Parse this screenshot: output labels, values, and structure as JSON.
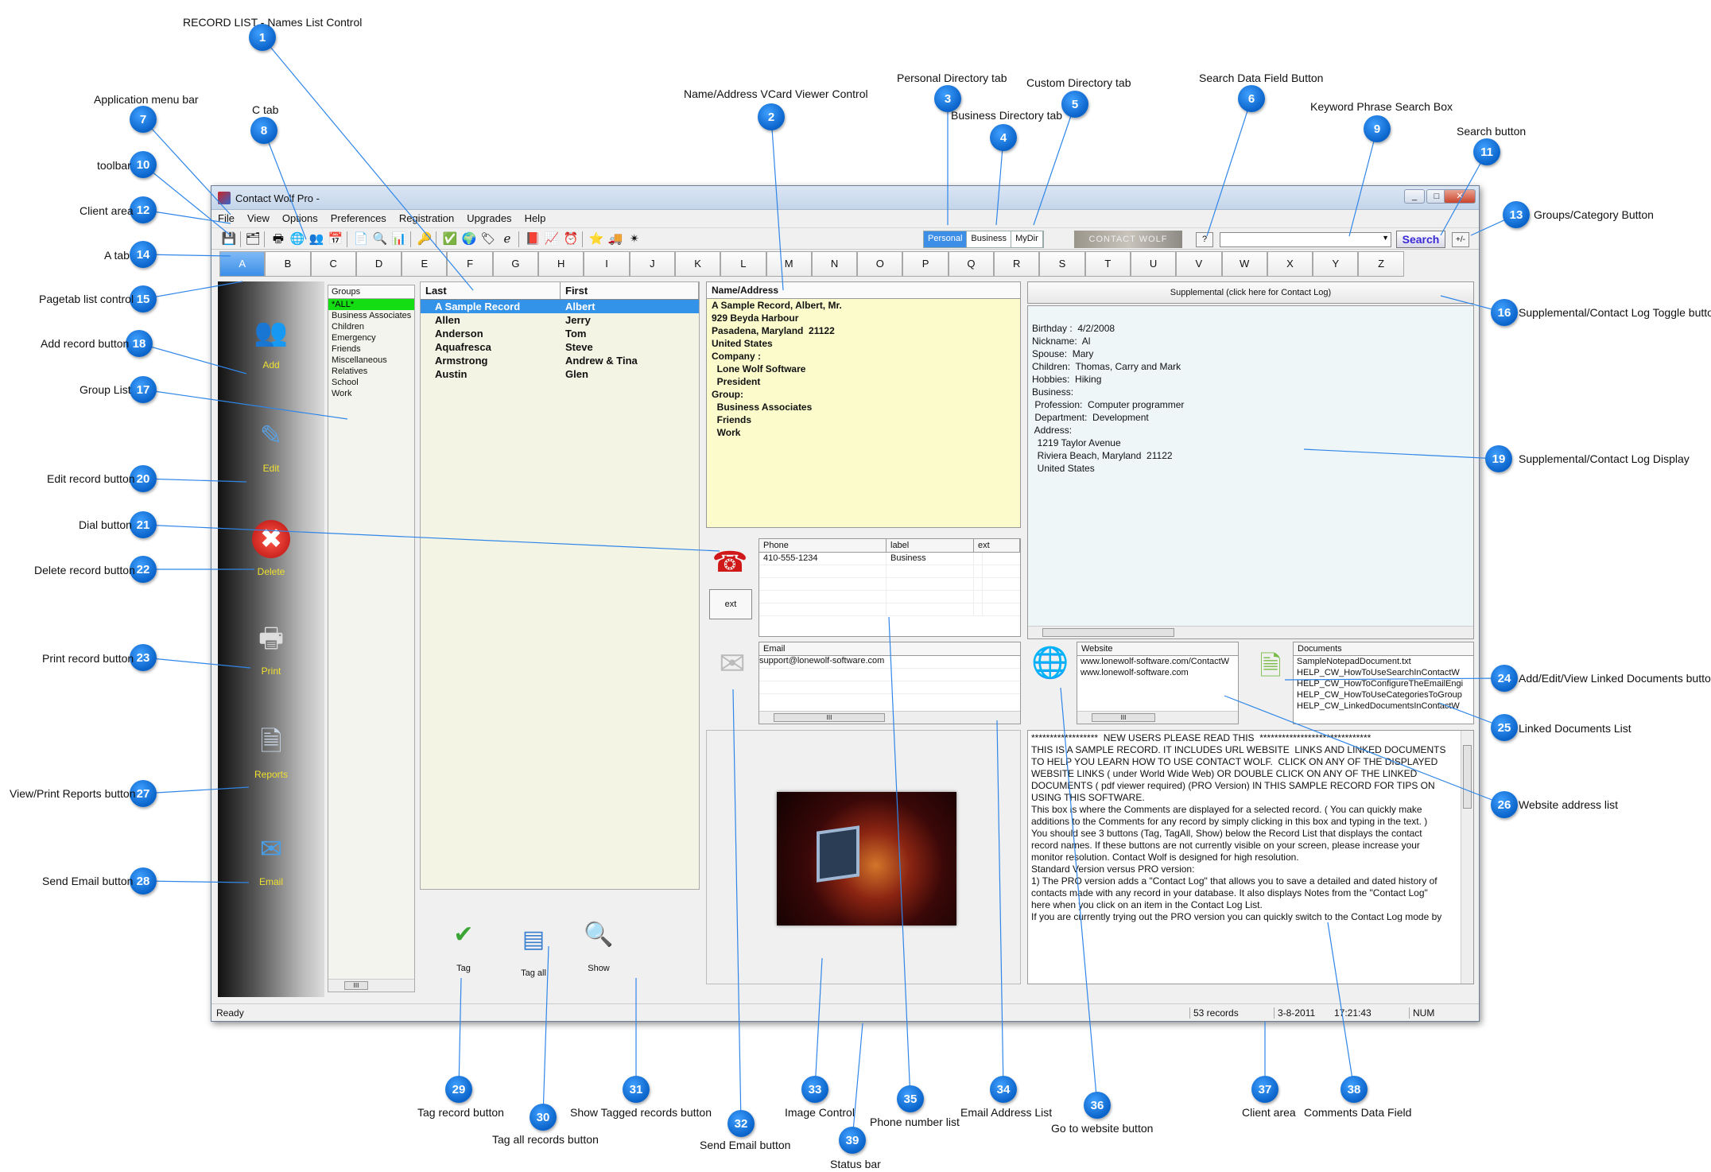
{
  "window": {
    "title": "Contact Wolf Pro -",
    "controls": [
      "minimize-icon",
      "maximize-icon",
      "close-icon"
    ]
  },
  "menu": [
    "File",
    "View",
    "Options",
    "Preferences",
    "Registration",
    "Upgrades",
    "Help"
  ],
  "toolbar": {
    "directory_tabs": [
      "Personal",
      "Business",
      "MyDir"
    ],
    "logo_text": "CONTACT WOLF",
    "search_field_button": "?",
    "search_placeholder": "",
    "search_button": "Search",
    "groups_button": "+/-"
  },
  "page_tabs": [
    "A",
    "B",
    "C",
    "D",
    "E",
    "F",
    "G",
    "H",
    "I",
    "J",
    "K",
    "L",
    "M",
    "N",
    "O",
    "P",
    "Q",
    "R",
    "S",
    "T",
    "U",
    "V",
    "W",
    "X",
    "Y",
    "Z"
  ],
  "sidebar": [
    {
      "label": "Add",
      "icon": "add-users-icon"
    },
    {
      "label": "Edit",
      "icon": "edit-user-icon"
    },
    {
      "label": "Delete",
      "icon": "delete-x-icon"
    },
    {
      "label": "Print",
      "icon": "printer-icon"
    },
    {
      "label": "Reports",
      "icon": "report-document-icon"
    },
    {
      "label": "Email",
      "icon": "email-globe-icon"
    }
  ],
  "groups": {
    "header": "Groups",
    "items": [
      "*ALL*",
      "Business Associates",
      "Children",
      "Emergency",
      "Friends",
      "Miscellaneous",
      "Relatives",
      "School",
      "Work"
    ]
  },
  "records": {
    "columns": [
      "Last",
      "First"
    ],
    "rows": [
      [
        "A Sample Record",
        "Albert"
      ],
      [
        "Allen",
        "Jerry"
      ],
      [
        "Anderson",
        "Tom"
      ],
      [
        "Aquafresca",
        "Steve"
      ],
      [
        "Armstrong",
        "Andrew & Tina"
      ],
      [
        "Austin",
        "Glen"
      ]
    ]
  },
  "tag_buttons": [
    "Tag",
    "Tag all",
    "Show"
  ],
  "vcard": {
    "header": "Name/Address",
    "lines": [
      "A Sample Record, Albert, Mr.",
      "929 Beyda Harbour",
      "Pasadena, Maryland  21122",
      "United States",
      "",
      "Company :",
      "  Lone Wolf Software",
      "  President",
      "",
      "Group:",
      "  Business Associates",
      "  Friends",
      "  Work"
    ]
  },
  "phone": {
    "ext_button": "ext",
    "columns": [
      "Phone",
      "label",
      "ext"
    ],
    "rows": [
      [
        "410-555-1234",
        "Business",
        ""
      ]
    ]
  },
  "email": {
    "columns": [
      "Email"
    ],
    "rows": [
      "support@lonewolf-software.com"
    ]
  },
  "supplemental": {
    "button": "Supplemental (click here for Contact Log)",
    "lines": [
      "Birthday :  4/2/2008",
      "Nickname:  Al",
      "Spouse:  Mary",
      "Children:  Thomas, Carry and Mark",
      "Hobbies:  Hiking",
      "",
      "Business:",
      " Profession:  Computer programmer",
      " Department:  Development",
      " Address:",
      "  1219 Taylor Avenue",
      "  Riviera Beach, Maryland  21122",
      "  United States"
    ]
  },
  "website": {
    "header": "Website",
    "rows": [
      "www.lonewolf-software.com/ContactW",
      "www.lonewolf-software.com"
    ]
  },
  "documents": {
    "header": "Documents",
    "rows": [
      "SampleNotepadDocument.txt",
      "HELP_CW_HowToUseSearchInContactW",
      "HELP_CW_HowToConfigureTheEmailEngi",
      "HELP_CW_HowToUseCategoriesToGroup",
      "HELP_CW_LinkedDocumentsInContactW"
    ]
  },
  "comments": [
    "******************  NEW USERS PLEASE READ THIS  ******************************",
    "",
    "THIS IS A SAMPLE RECORD. IT INCLUDES URL WEBSITE  LINKS AND LINKED DOCUMENTS",
    "TO HELP YOU LEARN HOW TO USE CONTACT WOLF.  CLICK ON ANY OF THE DISPLAYED",
    "WEBSITE LINKS ( under World Wide Web) OR DOUBLE CLICK ON ANY OF THE LINKED",
    "DOCUMENTS ( pdf viewer required) (PRO Version) IN THIS SAMPLE RECORD FOR TIPS ON",
    "USING THIS SOFTWARE.",
    "",
    "This box is where the Comments are displayed for a selected record. ( You can quickly make",
    "additions to the Comments for any record by simply clicking in this box and typing in the text. )",
    "",
    "You should see 3 buttons (Tag, TagAll, Show) below the Record List that displays the contact",
    "record names. If these buttons are not currently visible on your screen, please increase your",
    "monitor resolution. Contact Wolf is designed for high resolution.",
    "",
    "Standard Version versus PRO version:",
    "",
    "1) The PRO version adds a \"Contact Log\" that allows you to save a detailed and dated history of",
    "contacts made with any record in your database. It also displays Notes from the \"Contact Log\"",
    "here when you click on an item in the Contact Log List.",
    "If you are currently trying out the PRO version you can quickly switch to the Contact Log mode by"
  ],
  "status": {
    "text": "Ready",
    "records": "53 records",
    "date": "3-8-2011",
    "time": "17:21:43",
    "num": "NUM"
  },
  "callouts": [
    {
      "n": "1",
      "label": "RECORD LIST - Names List Control"
    },
    {
      "n": "2",
      "label": "Name/Address VCard Viewer Control"
    },
    {
      "n": "3",
      "label": "Personal Directory tab"
    },
    {
      "n": "4",
      "label": "Business Directory tab"
    },
    {
      "n": "5",
      "label": "Custom Directory tab"
    },
    {
      "n": "6",
      "label": "Search Data Field Button"
    },
    {
      "n": "7",
      "label": "Application menu bar"
    },
    {
      "n": "8",
      "label": "C tab"
    },
    {
      "n": "9",
      "label": "Keyword Phrase Search Box"
    },
    {
      "n": "10",
      "label": "toolbar"
    },
    {
      "n": "11",
      "label": "Search button"
    },
    {
      "n": "12",
      "label": "Client area"
    },
    {
      "n": "13",
      "label": "Groups/Category Button"
    },
    {
      "n": "14",
      "label": "A tab"
    },
    {
      "n": "15",
      "label": "Pagetab list control"
    },
    {
      "n": "16",
      "label": "Supplemental/Contact Log Toggle button"
    },
    {
      "n": "17",
      "label": "Group List"
    },
    {
      "n": "18",
      "label": "Add record button"
    },
    {
      "n": "19",
      "label": "Supplemental/Contact Log Display"
    },
    {
      "n": "20",
      "label": "Edit record button"
    },
    {
      "n": "21",
      "label": "Dial button"
    },
    {
      "n": "22",
      "label": "Delete record button"
    },
    {
      "n": "23",
      "label": "Print record button"
    },
    {
      "n": "24",
      "label": "Add/Edit/View Linked Documents button"
    },
    {
      "n": "25",
      "label": "Linked Documents List"
    },
    {
      "n": "26",
      "label": "Website address list"
    },
    {
      "n": "27",
      "label": "View/Print Reports button"
    },
    {
      "n": "28",
      "label": "Send Email button"
    },
    {
      "n": "29",
      "label": "Tag record button"
    },
    {
      "n": "30",
      "label": "Tag all records button"
    },
    {
      "n": "31",
      "label": "Show Tagged records button"
    },
    {
      "n": "32",
      "label": "Send Email button"
    },
    {
      "n": "33",
      "label": "Image Control"
    },
    {
      "n": "34",
      "label": "Email Address List"
    },
    {
      "n": "35",
      "label": "Phone number list"
    },
    {
      "n": "36",
      "label": "Go to website button"
    },
    {
      "n": "37",
      "label": "Client area"
    },
    {
      "n": "38",
      "label": "Comments Data Field"
    },
    {
      "n": "39",
      "label": "Status bar"
    }
  ]
}
